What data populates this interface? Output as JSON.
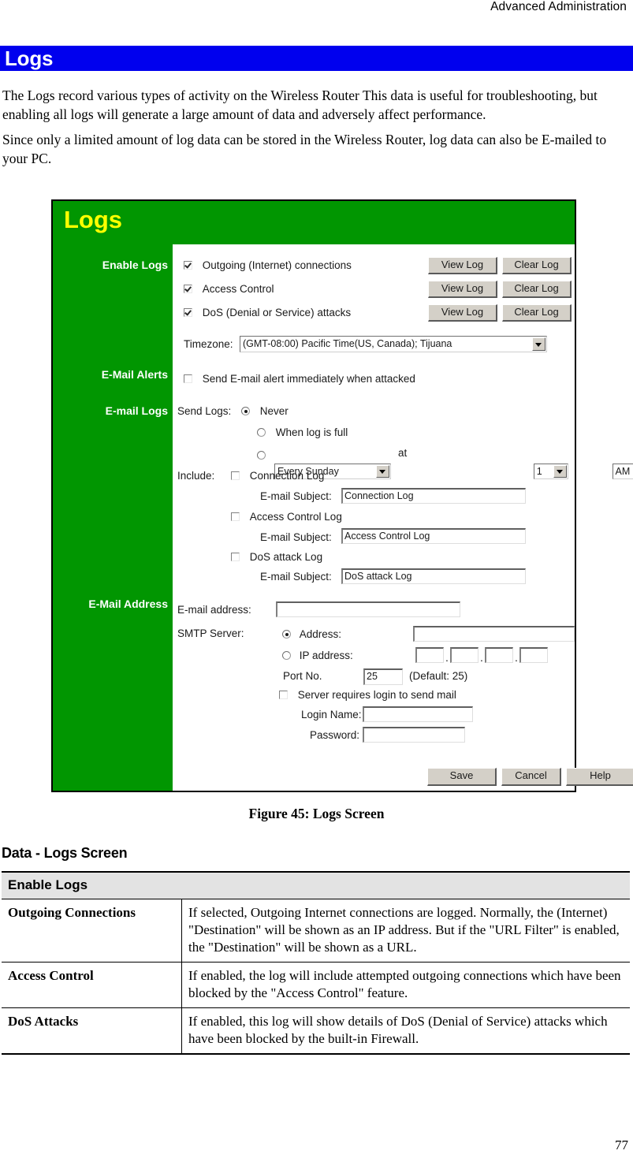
{
  "header": {
    "running_title": "Advanced Administration"
  },
  "title_bar": {
    "title": "Logs"
  },
  "intro": {
    "p1": "The Logs record various types of activity on the Wireless Router This data is useful for troubleshooting, but enabling all logs will generate a large amount of data and adversely affect performance.",
    "p2": "Since only a limited amount of log data can be stored in the Wireless Router, log data can also be E-mailed to your PC."
  },
  "screenshot": {
    "logo": "Logs",
    "sidebar": {
      "enable_logs": "Enable Logs",
      "email_alerts": "E-Mail Alerts",
      "email_logs": "E-mail Logs",
      "email_address": "E-Mail Address"
    },
    "enable_logs": {
      "rows": [
        {
          "label": "Outgoing (Internet) connections",
          "checked": true,
          "view": "View Log",
          "clear": "Clear Log"
        },
        {
          "label": "Access Control",
          "checked": true,
          "view": "View Log",
          "clear": "Clear Log"
        },
        {
          "label": "DoS (Denial or Service) attacks",
          "checked": true,
          "view": "View Log",
          "clear": "Clear Log"
        }
      ],
      "timezone_label": "Timezone:",
      "timezone_value": "(GMT-08:00) Pacific Time(US, Canada); Tijuana"
    },
    "email_alerts": {
      "alert_checkbox_label": "Send E-mail alert immediately when attacked",
      "alert_checked": false
    },
    "email_logs": {
      "send_logs_label": "Send Logs:",
      "option_never": "Never",
      "option_when_full": "When log is full",
      "selected_option": "Never",
      "schedule_day": "Every Sunday",
      "at_label": "at",
      "schedule_hour": "1",
      "schedule_ampm": "AM",
      "include_label": "Include:",
      "items": [
        {
          "label": "Connection Log",
          "checked": false,
          "subject_label": "E-mail Subject:",
          "subject_value": "Connection Log"
        },
        {
          "label": "Access Control Log",
          "checked": false,
          "subject_label": "E-mail Subject:",
          "subject_value": "Access Control Log"
        },
        {
          "label": "DoS attack Log",
          "checked": false,
          "subject_label": "E-mail Subject:",
          "subject_value": "DoS attack Log"
        }
      ]
    },
    "email_address": {
      "email_label": "E-mail address:",
      "email_value": "",
      "smtp_label": "SMTP Server:",
      "address_radio_label": "Address:",
      "address_value": "",
      "address_selected": true,
      "ip_radio_label": "IP address:",
      "ip_octets": [
        "",
        "",
        "",
        ""
      ],
      "ip_selected": false,
      "port_label": "Port No.",
      "port_value": "25",
      "port_default_note": "(Default: 25)",
      "login_required_label": "Server requires login to send mail",
      "login_required_checked": false,
      "login_name_label": "Login Name:",
      "login_name_value": "",
      "password_label": "Password:",
      "password_value": ""
    },
    "buttons": {
      "save": "Save",
      "cancel": "Cancel",
      "help": "Help"
    },
    "colors": {
      "banner_green": "#019601",
      "logo_yellow": "#ffff00",
      "button_face": "#d4d0c8"
    }
  },
  "figure": {
    "caption": "Figure 45: Logs Screen"
  },
  "data_section": {
    "heading": "Data - Logs Screen",
    "group_header": "Enable Logs",
    "rows": [
      {
        "key": "Outgoing Connections",
        "value": "If selected, Outgoing Internet connections are logged. Normally, the (Internet) \"Destination\" will be shown as an IP address. But if the \"URL Filter\" is enabled, the \"Destination\" will be shown as a URL."
      },
      {
        "key": "Access Control",
        "value": "If enabled, the log will include attempted outgoing connections which have been blocked by the \"Access Control\" feature."
      },
      {
        "key": "DoS Attacks",
        "value": "If enabled, this log will show details of DoS (Denial of Service) attacks which have been blocked by the built-in Firewall."
      }
    ]
  },
  "footer": {
    "page_number": "77"
  }
}
